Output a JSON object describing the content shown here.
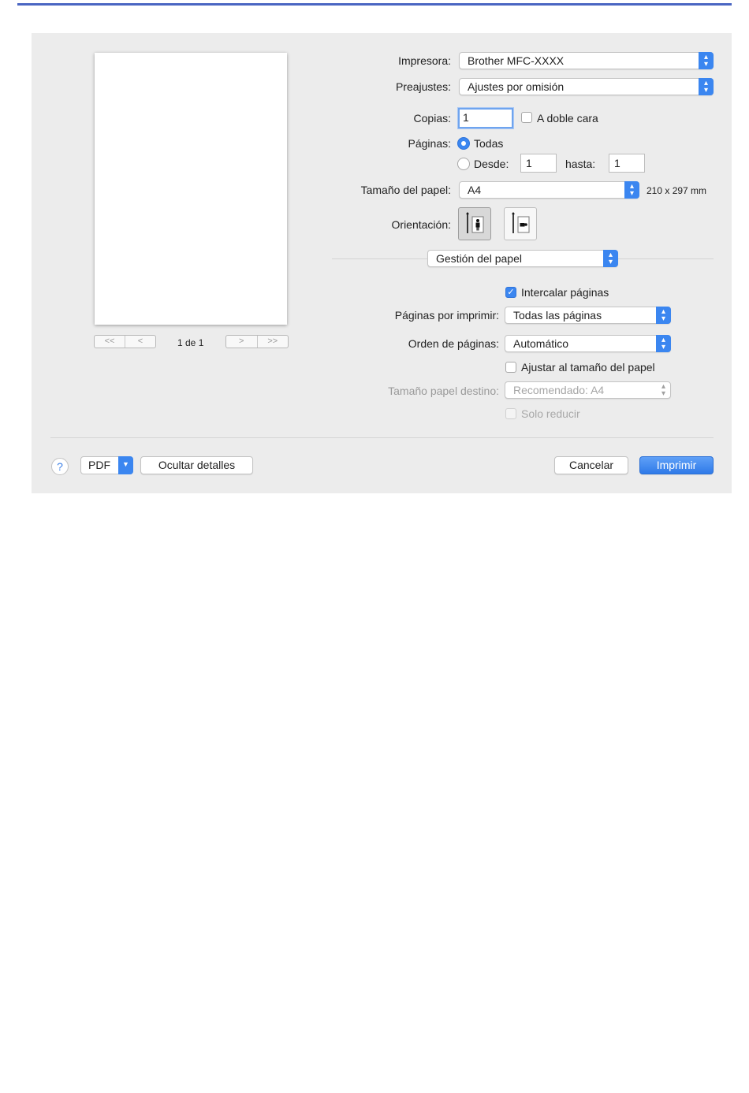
{
  "preview": {
    "nav_first": "<<",
    "nav_prev": "<",
    "nav_next": ">",
    "nav_last": ">>",
    "page_count": "1 de 1"
  },
  "printer": {
    "label": "Impresora:",
    "value": "Brother MFC-XXXX"
  },
  "presets": {
    "label": "Preajustes:",
    "value": "Ajustes por omisión"
  },
  "copies": {
    "label": "Copias:",
    "value": "1",
    "duplex_label": "A doble cara",
    "duplex_checked": false
  },
  "pages": {
    "label": "Páginas:",
    "all_label": "Todas",
    "from_label": "Desde:",
    "from_value": "1",
    "to_label": "hasta:",
    "to_value": "1"
  },
  "paper_size": {
    "label": "Tamaño del papel:",
    "value": "A4",
    "dimensions": "210 x 297 mm"
  },
  "orientation": {
    "label": "Orientación:",
    "options": [
      "portrait",
      "landscape"
    ],
    "selected": "portrait"
  },
  "section": {
    "value": "Gestión del papel"
  },
  "paper_handling": {
    "collate_label": "Intercalar páginas",
    "collate_checked": true,
    "pages_to_print_label": "Páginas por imprimir:",
    "pages_to_print_value": "Todas las páginas",
    "page_order_label": "Orden de páginas:",
    "page_order_value": "Automático",
    "scale_to_fit_label": "Ajustar al tamaño del papel",
    "scale_to_fit_checked": false,
    "dest_size_label": "Tamaño papel destino:",
    "dest_size_value": "Recomendado: A4",
    "scale_down_label": "Solo reducir"
  },
  "footer": {
    "help_label": "?",
    "pdf_label": "PDF",
    "hide_details_label": "Ocultar detalles",
    "cancel_label": "Cancelar",
    "print_label": "Imprimir"
  },
  "colors": {
    "accent": "#3b86f0",
    "top_rule": "#4a66c2",
    "dialog_bg": "#ececec"
  }
}
